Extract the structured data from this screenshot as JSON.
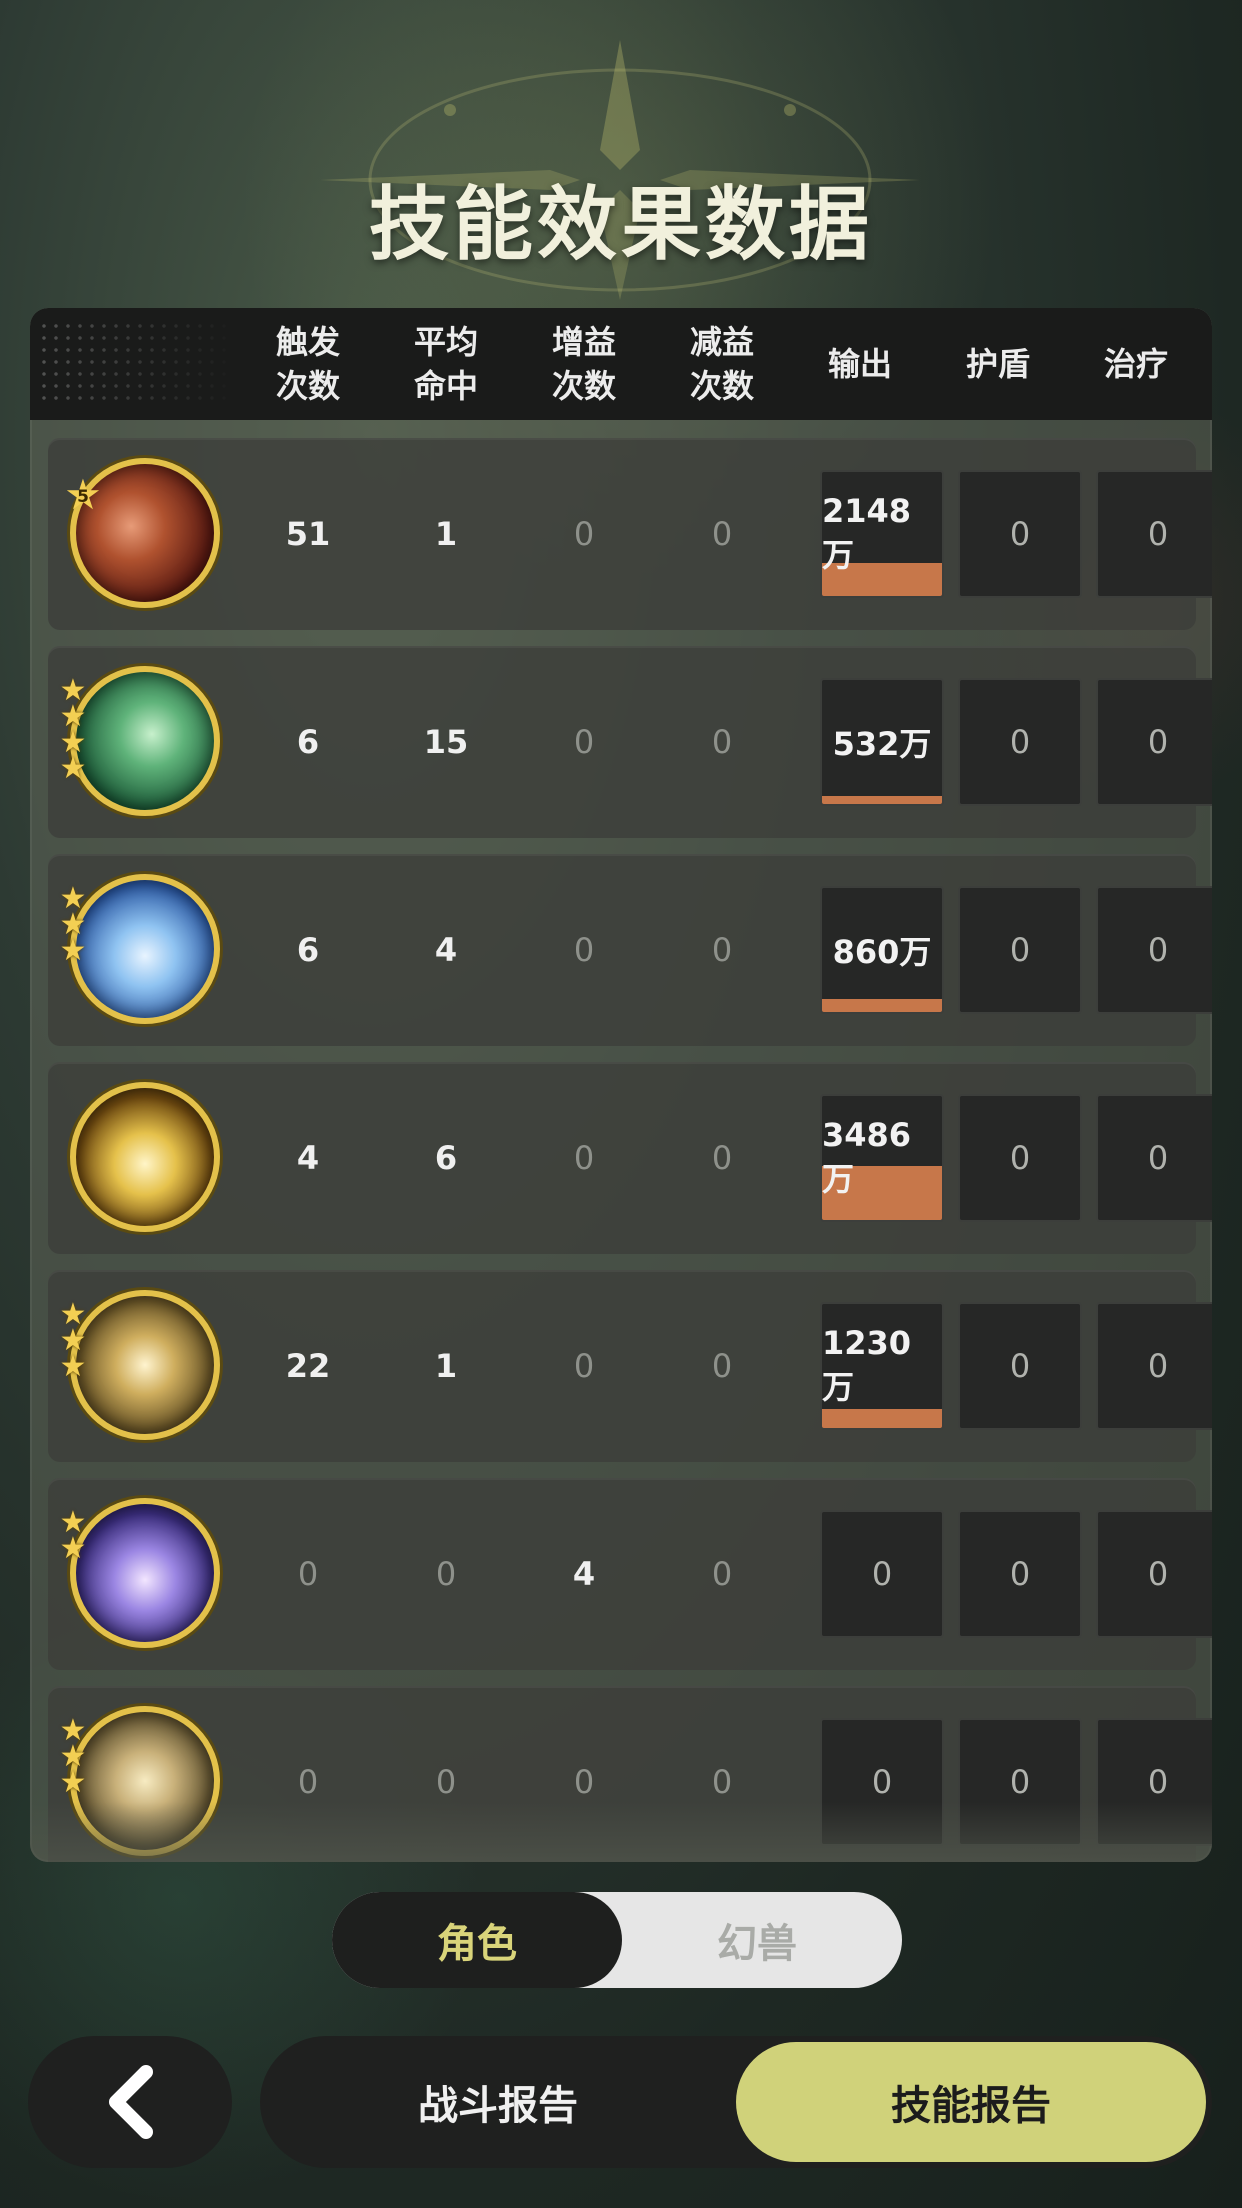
{
  "page": {
    "title": "技能效果数据"
  },
  "table": {
    "headers": [
      {
        "label": "触发\n次数"
      },
      {
        "label": "平均\n命中"
      },
      {
        "label": "增益\n次数"
      },
      {
        "label": "减益\n次数"
      },
      {
        "label": "输出"
      },
      {
        "label": "护盾"
      },
      {
        "label": "治疗"
      }
    ],
    "rows": [
      {
        "icon": "meteor-skill-icon",
        "stars": 5,
        "star_badge": true,
        "trigger": "51",
        "avg_hit": "1",
        "buff": "0",
        "debuff": "0",
        "output": "2148万",
        "output_ratio": 0.26,
        "shield": "0",
        "heal": "0"
      },
      {
        "icon": "wind-claw-skill-icon",
        "stars": 4,
        "star_badge": false,
        "trigger": "6",
        "avg_hit": "15",
        "buff": "0",
        "debuff": "0",
        "output": "532万",
        "output_ratio": 0.06,
        "shield": "0",
        "heal": "0"
      },
      {
        "icon": "ice-burst-skill-icon",
        "stars": 3,
        "star_badge": false,
        "trigger": "6",
        "avg_hit": "4",
        "buff": "0",
        "debuff": "0",
        "output": "860万",
        "output_ratio": 0.1,
        "shield": "0",
        "heal": "0"
      },
      {
        "icon": "lightning-orb-skill-icon",
        "stars": 0,
        "star_badge": false,
        "trigger": "4",
        "avg_hit": "6",
        "buff": "0",
        "debuff": "0",
        "output": "3486万",
        "output_ratio": 0.42,
        "shield": "0",
        "heal": "0"
      },
      {
        "icon": "golden-shield-skill-icon",
        "stars": 3,
        "star_badge": false,
        "trigger": "22",
        "avg_hit": "1",
        "buff": "0",
        "debuff": "0",
        "output": "1230万",
        "output_ratio": 0.15,
        "shield": "0",
        "heal": "0"
      },
      {
        "icon": "starlight-skill-icon",
        "stars": 2,
        "star_badge": false,
        "trigger": "0",
        "avg_hit": "0",
        "buff": "4",
        "debuff": "0",
        "output": "0",
        "output_ratio": 0,
        "shield": "0",
        "heal": "0"
      },
      {
        "icon": "golden-arrow-skill-icon",
        "stars": 3,
        "star_badge": false,
        "trigger": "0",
        "avg_hit": "0",
        "buff": "0",
        "debuff": "0",
        "output": "0",
        "output_ratio": 0,
        "shield": "0",
        "heal": "0"
      }
    ]
  },
  "toggle": {
    "options": [
      "角色",
      "幻兽"
    ],
    "selected": "角色"
  },
  "bottom_nav": {
    "back_icon": "chevron-left-icon",
    "tabs": [
      "战斗报告",
      "技能报告"
    ],
    "active_tab": "技能报告"
  },
  "colors": {
    "accent": "#d0d27a",
    "output_bar": "#c7774a",
    "icon_ring": "#e3c14a"
  }
}
